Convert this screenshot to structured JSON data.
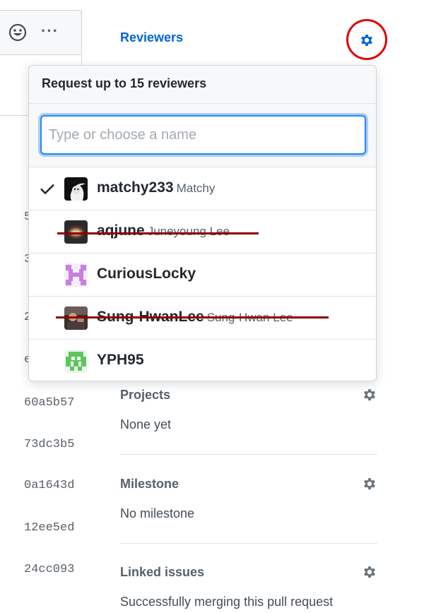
{
  "commits": [
    "5",
    "3",
    "2",
    "e",
    "60a5b57",
    "73dc3b5",
    "0a1643d",
    "12ee5ed",
    "24cc093"
  ],
  "toolbar": {
    "emoji_icon": "smiley-icon",
    "more_icon": "kebab-horizontal-icon",
    "more_label": "···"
  },
  "sidebar": {
    "reviewers": {
      "title": "Reviewers"
    },
    "projects": {
      "title": "Projects",
      "value": "None yet"
    },
    "milestone": {
      "title": "Milestone",
      "value": "No milestone"
    },
    "linked_issues": {
      "title": "Linked issues",
      "value": "Successfully merging this pull request"
    }
  },
  "reviewer_popover": {
    "title": "Request up to 15 reviewers",
    "filter_placeholder": "Type or choose a name",
    "filter_value": "",
    "items": [
      {
        "login": "matchy233",
        "name": "Matchy",
        "selected": true,
        "struck": false
      },
      {
        "login": "aqjune",
        "name": "Juneyoung Lee",
        "selected": false,
        "struck": true
      },
      {
        "login": "CuriousLocky",
        "name": "",
        "selected": false,
        "struck": false
      },
      {
        "login": "Sung-HwanLee",
        "name": "Sung-Hwan Lee",
        "selected": false,
        "struck": true
      },
      {
        "login": "YPH95",
        "name": "",
        "selected": false,
        "struck": false
      }
    ]
  },
  "colors": {
    "link_blue": "#0366d6",
    "highlight_red": "#e00000",
    "strike_red": "#8b0000",
    "gear_gray": "#6a737d"
  }
}
